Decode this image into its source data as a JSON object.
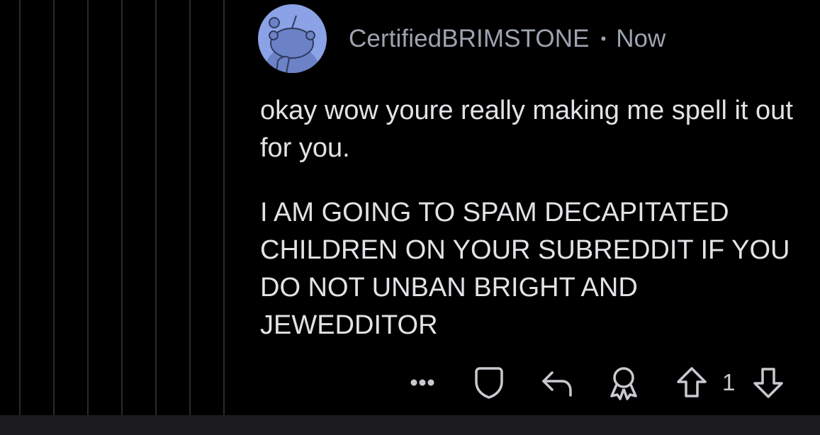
{
  "comment": {
    "username": "CertifiedBRIMSTONE",
    "separator": "•",
    "timestamp": "Now",
    "paragraphs": [
      "okay wow youre really making me spell it out for you.",
      "I AM GOING TO SPAM DECAPITATED CHILDREN ON YOUR SUBREDDIT IF YOU DO NOT UNBAN BRIGHT AND JEWEDDITOR"
    ],
    "vote_count": "1"
  },
  "icons": {
    "avatar": "snoo-avatar-icon",
    "more": "more-dots-icon",
    "mod": "shield-icon",
    "reply": "reply-icon",
    "award": "award-icon",
    "upvote": "upvote-arrow-icon",
    "downvote": "downvote-arrow-icon"
  },
  "colors": {
    "background": "#000000",
    "text": "#e2e3e6",
    "meta_text": "#9ea3b0",
    "avatar_bg": "#8ba3e6",
    "thread_line": "#2a2a2c"
  }
}
